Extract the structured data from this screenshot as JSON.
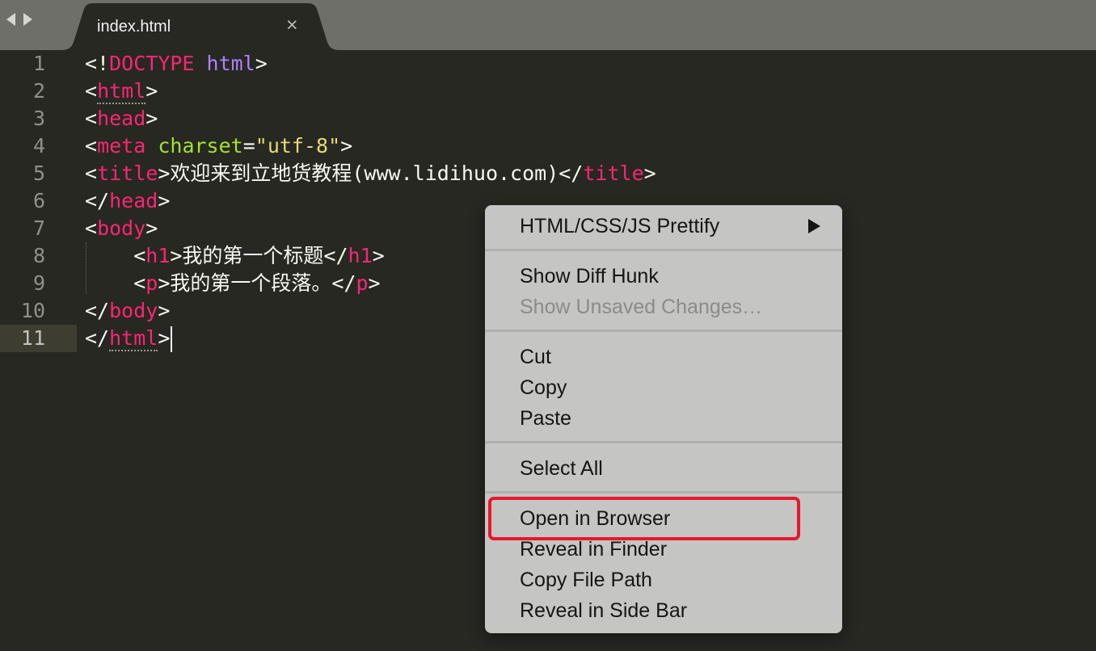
{
  "tab": {
    "title": "index.html",
    "close_glyph": "×"
  },
  "editor": {
    "lines": [
      {
        "num": "1",
        "parts": [
          [
            "<!",
            ""
          ],
          [
            "DOCTYPE",
            "tag"
          ],
          [
            " ",
            ""
          ],
          [
            "html",
            "kw"
          ],
          [
            ">",
            ""
          ]
        ]
      },
      {
        "num": "2",
        "parts": [
          [
            "<",
            ""
          ],
          [
            "html",
            "tag ul"
          ],
          [
            ">",
            ""
          ]
        ]
      },
      {
        "num": "3",
        "parts": [
          [
            "<",
            ""
          ],
          [
            "head",
            "tag"
          ],
          [
            ">",
            ""
          ]
        ]
      },
      {
        "num": "4",
        "parts": [
          [
            "<",
            ""
          ],
          [
            "meta",
            "tag"
          ],
          [
            " ",
            ""
          ],
          [
            "charset",
            "attr"
          ],
          [
            "=",
            ""
          ],
          [
            "\"utf-8\"",
            "str"
          ],
          [
            ">",
            ""
          ]
        ]
      },
      {
        "num": "5",
        "parts": [
          [
            "<",
            ""
          ],
          [
            "title",
            "tag"
          ],
          [
            ">欢迎来到立地货教程(www.lidihuo.com)</",
            ""
          ],
          [
            "title",
            "tag"
          ],
          [
            ">",
            ""
          ]
        ]
      },
      {
        "num": "6",
        "parts": [
          [
            "</",
            ""
          ],
          [
            "head",
            "tag"
          ],
          [
            ">",
            ""
          ]
        ]
      },
      {
        "num": "7",
        "parts": [
          [
            "<",
            ""
          ],
          [
            "body",
            "tag"
          ],
          [
            ">",
            ""
          ]
        ]
      },
      {
        "num": "8",
        "parts": [
          [
            "    <",
            ""
          ],
          [
            "h1",
            "tag"
          ],
          [
            ">我的第一个标题</",
            ""
          ],
          [
            "h1",
            "tag"
          ],
          [
            ">",
            ""
          ]
        ]
      },
      {
        "num": "9",
        "parts": [
          [
            "    <",
            ""
          ],
          [
            "p",
            "tag"
          ],
          [
            ">我的第一个段落。</",
            ""
          ],
          [
            "p",
            "tag"
          ],
          [
            ">",
            ""
          ]
        ]
      },
      {
        "num": "10",
        "parts": [
          [
            "</",
            ""
          ],
          [
            "body",
            "tag"
          ],
          [
            ">",
            ""
          ]
        ]
      },
      {
        "num": "11",
        "parts": [
          [
            "</",
            ""
          ],
          [
            "html",
            "tag ul"
          ],
          [
            ">",
            ""
          ]
        ],
        "current": true
      }
    ]
  },
  "context_menu": {
    "groups": [
      [
        {
          "label": "HTML/CSS/JS Prettify",
          "submenu": true
        }
      ],
      [
        {
          "label": "Show Diff Hunk"
        },
        {
          "label": "Show Unsaved Changes…",
          "disabled": true
        }
      ],
      [
        {
          "label": "Cut"
        },
        {
          "label": "Copy"
        },
        {
          "label": "Paste"
        }
      ],
      [
        {
          "label": "Select All"
        }
      ],
      [
        {
          "label": "Open in Browser",
          "highlighted": true
        },
        {
          "label": "Reveal in Finder"
        },
        {
          "label": "Copy File Path"
        },
        {
          "label": "Reveal in Side Bar"
        }
      ]
    ],
    "highlight_color": "#e8172d"
  },
  "theme": {
    "background": "#272822",
    "tag": "#f92672",
    "attribute": "#a6e22e",
    "string": "#e6db74",
    "keyword": "#ae81ff"
  }
}
